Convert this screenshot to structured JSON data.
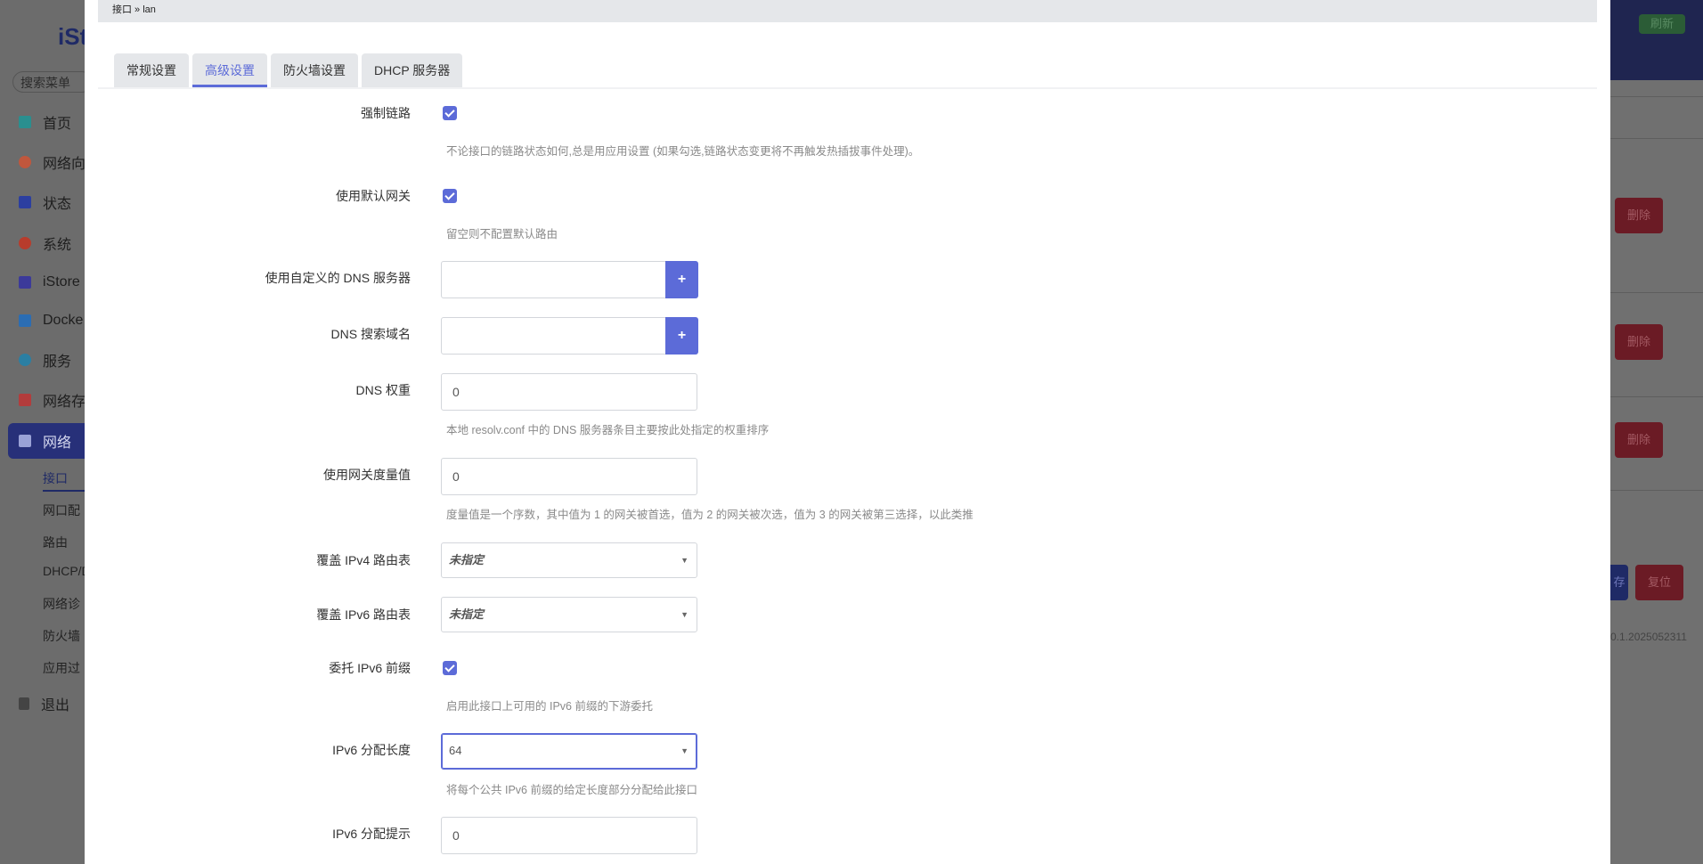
{
  "background": {
    "logo": "iSt",
    "search_placeholder": "搜索菜单",
    "nav": [
      {
        "label": "首页",
        "icon": "home-icon",
        "color": "#2a8f8f"
      },
      {
        "label": "网络向",
        "icon": "wizard-icon",
        "color": "#c0573d"
      },
      {
        "label": "状态",
        "icon": "dashboard-icon",
        "color": "#2c3fa0"
      },
      {
        "label": "系统",
        "icon": "gear-icon",
        "color": "#b83c2c"
      },
      {
        "label": "iStore",
        "icon": "store-icon",
        "color": "#3c3a9a"
      },
      {
        "label": "Docke",
        "icon": "docker-icon",
        "color": "#2b6db3"
      },
      {
        "label": "服务",
        "icon": "link-icon",
        "color": "#2b7fa3"
      },
      {
        "label": "网络存",
        "icon": "storage-icon",
        "color": "#b33c3c"
      },
      {
        "label": "网络",
        "icon": "network-icon",
        "color": "#9aa2d6"
      }
    ],
    "subnav": [
      "接口",
      "网口配",
      "路由",
      "DHCP/D",
      "网络诊",
      "防火墙",
      "应用过"
    ],
    "logout": "退出",
    "refresh": "刷新",
    "delete": "删除",
    "save": "存",
    "reset": "复位",
    "version": "0.1.2025052311"
  },
  "breadcrumb": "接口 » lan",
  "tabs": [
    "常规设置",
    "高级设置",
    "防火墙设置",
    "DHCP 服务器"
  ],
  "active_tab": "高级设置",
  "form": {
    "force_link": {
      "label": "强制链路",
      "checked": true,
      "desc": "不论接口的链路状态如何,总是用应用设置 (如果勾选,链路状态变更将不再触发热插拔事件处理)。"
    },
    "default_gateway": {
      "label": "使用默认网关",
      "checked": true,
      "desc": "留空则不配置默认路由"
    },
    "custom_dns": {
      "label": "使用自定义的 DNS 服务器",
      "value": "",
      "add": "+"
    },
    "dns_search": {
      "label": "DNS 搜索域名",
      "value": "",
      "add": "+"
    },
    "dns_weight": {
      "label": "DNS 权重",
      "value": "0",
      "desc": "本地 resolv.conf 中的 DNS 服务器条目主要按此处指定的权重排序"
    },
    "gateway_metric": {
      "label": "使用网关度量值",
      "value": "0",
      "desc": "度量值是一个序数，其中值为 1 的网关被首选，值为 2 的网关被次选，值为 3 的网关被第三选择，以此类推"
    },
    "ipv4_table": {
      "label": "覆盖 IPv4 路由表",
      "value": "未指定"
    },
    "ipv6_table": {
      "label": "覆盖 IPv6 路由表",
      "value": "未指定"
    },
    "delegate_prefix": {
      "label": "委托 IPv6 前缀",
      "checked": true,
      "desc": "启用此接口上可用的 IPv6 前缀的下游委托"
    },
    "ipv6_assign_len": {
      "label": "IPv6 分配长度",
      "value": "64",
      "desc": "将每个公共 IPv6 前缀的给定长度部分分配给此接口"
    },
    "ipv6_hint": {
      "label": "IPv6 分配提示",
      "value": "0"
    }
  }
}
